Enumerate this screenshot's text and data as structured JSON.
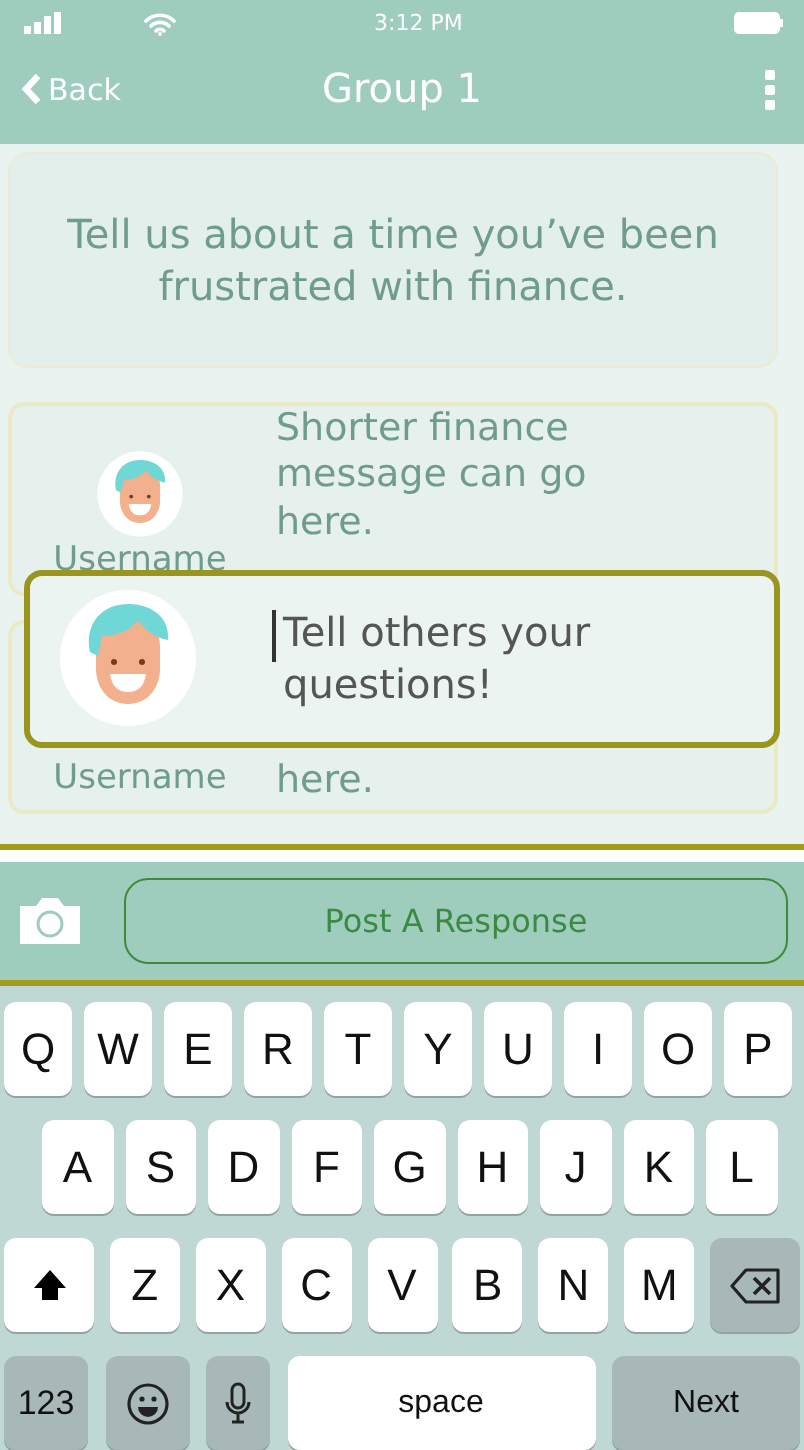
{
  "status_bar": {
    "time": "3:12 PM"
  },
  "nav": {
    "back": "Back",
    "title": "Group 1"
  },
  "prompt": {
    "text": "Tell us about a time you’ve been frustrated with finance."
  },
  "messages": [
    {
      "username": "Username",
      "text": "Shorter finance message can go here.",
      "avatar": true
    },
    {
      "username": "Username",
      "text": "here."
    }
  ],
  "compose": {
    "placeholder": "Tell others your questions!"
  },
  "post_bar": {
    "button": "Post A Response"
  },
  "keyboard": {
    "rows": [
      [
        {
          "kind": "letter",
          "label": "Q"
        },
        {
          "kind": "letter",
          "label": "W"
        },
        {
          "kind": "letter",
          "label": "E"
        },
        {
          "kind": "letter",
          "label": "R"
        },
        {
          "kind": "letter",
          "label": "T"
        },
        {
          "kind": "letter",
          "label": "Y"
        },
        {
          "kind": "letter",
          "label": "U"
        },
        {
          "kind": "letter",
          "label": "I"
        },
        {
          "kind": "letter",
          "label": "O"
        },
        {
          "kind": "letter",
          "label": "P"
        }
      ],
      [
        {
          "kind": "letter",
          "label": "A"
        },
        {
          "kind": "letter",
          "label": "S"
        },
        {
          "kind": "letter",
          "label": "D"
        },
        {
          "kind": "letter",
          "label": "F"
        },
        {
          "kind": "letter",
          "label": "G"
        },
        {
          "kind": "letter",
          "label": "H"
        },
        {
          "kind": "letter",
          "label": "J"
        },
        {
          "kind": "letter",
          "label": "K"
        },
        {
          "kind": "letter",
          "label": "L"
        }
      ],
      [
        {
          "kind": "shift"
        },
        {
          "kind": "letter",
          "label": "Z"
        },
        {
          "kind": "letter",
          "label": "X"
        },
        {
          "kind": "letter",
          "label": "C"
        },
        {
          "kind": "letter",
          "label": "V"
        },
        {
          "kind": "letter",
          "label": "B"
        },
        {
          "kind": "letter",
          "label": "N"
        },
        {
          "kind": "letter",
          "label": "M"
        },
        {
          "kind": "backspace"
        }
      ],
      [
        {
          "kind": "mode",
          "label": "123"
        },
        {
          "kind": "emoji"
        },
        {
          "kind": "mic"
        },
        {
          "kind": "space",
          "label": "space"
        },
        {
          "kind": "return",
          "label": "Next"
        }
      ]
    ]
  }
}
